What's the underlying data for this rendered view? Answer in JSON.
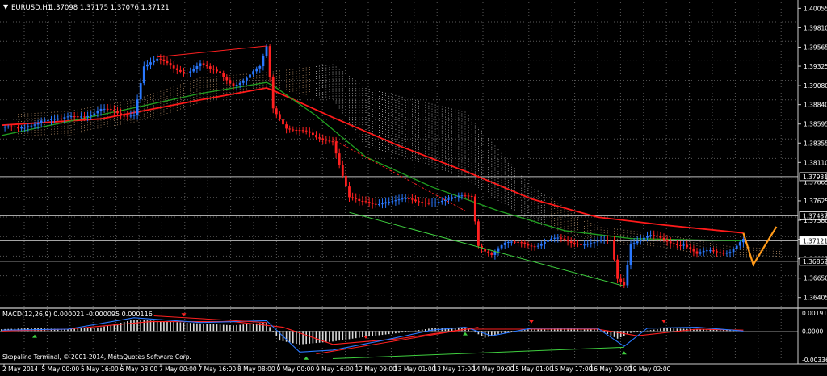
{
  "header": {
    "symbol": "EURUSD,H1",
    "quote": "1.37098 1.37175 1.37076 1.37121",
    "menu_icon": "triangle-down-icon"
  },
  "footer": {
    "copyright": "Skopalino Terminal, © 2001-2014, MetaQuotes Software Corp."
  },
  "colors": {
    "background": "#000000",
    "grid": "#5a5a5a",
    "bull": "#2a78ff",
    "bear": "#ff2020",
    "ma_red": "#ff1a1a",
    "ma_green": "#21a121",
    "cloud_white": "#d8d8d8",
    "cloud_tan": "#d4a678",
    "forecast": "#ff9a1a",
    "axis_text": "#ffffff"
  },
  "chart_data": [
    {
      "type": "candlestick",
      "title": "EURUSD,H1",
      "ylim": [
        1.3628,
        1.4013
      ],
      "y_ticks": [
        "1.40055",
        "1.39810",
        "1.39565",
        "1.39325",
        "1.39080",
        "1.38840",
        "1.38595",
        "1.38355",
        "1.38110",
        "1.37865",
        "1.37625",
        "1.37380",
        "1.37140",
        "1.36895",
        "1.36650",
        "1.36405"
      ],
      "level_labels": [
        "1.37931",
        "1.37437",
        "1.37121",
        "1.36862"
      ],
      "levels": [
        1.37931,
        1.37437,
        1.37121,
        1.36862
      ],
      "current_price": 1.37121,
      "x_ticks": [
        "2 May 2014",
        "5 May 00:00",
        "5 May 16:00",
        "6 May 08:00",
        "7 May 00:00",
        "7 May 16:00",
        "8 May 08:00",
        "9 May 00:00",
        "9 May 16:00",
        "12 May 09:00",
        "13 May 01:00",
        "13 May 17:00",
        "14 May 09:00",
        "15 May 01:00",
        "15 May 17:00",
        "16 May 09:00",
        "19 May 02:00"
      ],
      "price_path": [
        [
          0,
          1.3855
        ],
        [
          5,
          1.385
        ],
        [
          12,
          1.3868
        ],
        [
          18,
          1.3862
        ],
        [
          24,
          1.3872
        ],
        [
          30,
          1.3878
        ],
        [
          36,
          1.3868
        ],
        [
          40,
          1.3875
        ],
        [
          43,
          1.3935
        ],
        [
          47,
          1.3938
        ],
        [
          52,
          1.393
        ],
        [
          56,
          1.3928
        ],
        [
          60,
          1.3935
        ],
        [
          63,
          1.3925
        ],
        [
          66,
          1.3922
        ],
        [
          70,
          1.3912
        ],
        [
          74,
          1.3918
        ],
        [
          78,
          1.3928
        ],
        [
          80,
          1.3955
        ],
        [
          82,
          1.388
        ],
        [
          86,
          1.3858
        ],
        [
          90,
          1.385
        ],
        [
          95,
          1.384
        ],
        [
          100,
          1.3842
        ],
        [
          105,
          1.3765
        ],
        [
          108,
          1.3758
        ],
        [
          112,
          1.376
        ],
        [
          116,
          1.3765
        ],
        [
          120,
          1.3762
        ],
        [
          125,
          1.376
        ],
        [
          130,
          1.3765
        ],
        [
          136,
          1.3762
        ],
        [
          142,
          1.377
        ],
        [
          144,
          1.371
        ],
        [
          148,
          1.3695
        ],
        [
          152,
          1.3705
        ],
        [
          157,
          1.3712
        ],
        [
          162,
          1.3708
        ],
        [
          168,
          1.3712
        ],
        [
          174,
          1.3712
        ],
        [
          180,
          1.3708
        ],
        [
          184,
          1.371
        ],
        [
          186,
          1.3665
        ],
        [
          188,
          1.366
        ],
        [
          190,
          1.3712
        ],
        [
          196,
          1.3715
        ],
        [
          202,
          1.3712
        ],
        [
          206,
          1.371
        ],
        [
          210,
          1.3692
        ],
        [
          214,
          1.3698
        ],
        [
          220,
          1.3702
        ],
        [
          224,
          1.3712
        ]
      ],
      "moving_averages": [
        {
          "color": "red",
          "values": [
            [
              0,
              1.3858
            ],
            [
              30,
              1.3866
            ],
            [
              60,
              1.389
            ],
            [
              80,
              1.3905
            ],
            [
              82,
              1.3902
            ],
            [
              100,
              1.3868
            ],
            [
              120,
              1.3832
            ],
            [
              140,
              1.38
            ],
            [
              160,
              1.3765
            ],
            [
              180,
              1.3742
            ],
            [
              200,
              1.3732
            ],
            [
              224,
              1.3722
            ]
          ]
        },
        {
          "color": "green",
          "values": [
            [
              0,
              1.3845
            ],
            [
              40,
              1.388
            ],
            [
              60,
              1.3898
            ],
            [
              80,
              1.3912
            ],
            [
              82,
              1.3908
            ],
            [
              95,
              1.387
            ],
            [
              110,
              1.3818
            ],
            [
              130,
              1.378
            ],
            [
              150,
              1.375
            ],
            [
              170,
              1.3725
            ],
            [
              190,
              1.3715
            ],
            [
              224,
              1.3712
            ]
          ]
        }
      ],
      "trendlines": [
        {
          "color": "red",
          "from": [
            47,
            1.3944
          ],
          "to": [
            80,
            1.3958
          ]
        },
        {
          "color": "green",
          "from": [
            105,
            1.3748
          ],
          "to": [
            188,
            1.3655
          ]
        },
        {
          "color": "red",
          "from": [
            100,
            1.384
          ],
          "to": [
            140,
            1.375
          ]
        }
      ],
      "cloud": {
        "upper": [
          [
            4,
            1.3872
          ],
          [
            20,
            1.3876
          ],
          [
            40,
            1.389
          ],
          [
            60,
            1.3918
          ],
          [
            80,
            1.3925
          ],
          [
            100,
            1.3935
          ],
          [
            110,
            1.3905
          ],
          [
            120,
            1.3895
          ],
          [
            140,
            1.3875
          ],
          [
            160,
            1.378
          ],
          [
            180,
            1.373
          ],
          [
            200,
            1.372
          ],
          [
            220,
            1.3705
          ],
          [
            236,
            1.3702
          ]
        ],
        "lower": [
          [
            4,
            1.3843
          ],
          [
            20,
            1.3845
          ],
          [
            40,
            1.386
          ],
          [
            60,
            1.3885
          ],
          [
            80,
            1.3905
          ],
          [
            100,
            1.389
          ],
          [
            110,
            1.383
          ],
          [
            120,
            1.382
          ],
          [
            140,
            1.379
          ],
          [
            160,
            1.3735
          ],
          [
            180,
            1.371
          ],
          [
            200,
            1.3702
          ],
          [
            220,
            1.369
          ],
          [
            236,
            1.3692
          ]
        ]
      },
      "forecast": [
        [
          224,
          1.3722
        ],
        [
          227,
          1.3682
        ],
        [
          234,
          1.373
        ]
      ]
    },
    {
      "type": "bar",
      "title": "MACD(12,26,9) 0.000021 -0.000095 0.000116",
      "ylim": [
        -0.00345,
        0.00232
      ],
      "y_ticks": [
        "0.001913",
        "0.0000",
        "-0.003367"
      ],
      "y_tick_values": [
        0.001913,
        0.0,
        -0.003367
      ],
      "histogram": [
        [
          0,
          0.0002
        ],
        [
          10,
          0.0003
        ],
        [
          20,
          0.0002
        ],
        [
          30,
          0.0004
        ],
        [
          40,
          0.0012
        ],
        [
          50,
          0.001
        ],
        [
          60,
          0.0008
        ],
        [
          70,
          0.0006
        ],
        [
          80,
          0.0009
        ],
        [
          84,
          -0.001
        ],
        [
          90,
          -0.0014
        ],
        [
          100,
          -0.0011
        ],
        [
          110,
          -0.0006
        ],
        [
          120,
          -0.0002
        ],
        [
          130,
          0.0003
        ],
        [
          140,
          0.0004
        ],
        [
          146,
          -0.0007
        ],
        [
          150,
          -0.0003
        ],
        [
          160,
          0.0002
        ],
        [
          170,
          0.0003
        ],
        [
          180,
          0.0002
        ],
        [
          186,
          -0.0008
        ],
        [
          190,
          -0.0002
        ],
        [
          200,
          0.0003
        ],
        [
          210,
          0.0002
        ],
        [
          220,
          0.0001
        ],
        [
          224,
          0.0
        ]
      ],
      "macd_line": [
        [
          0,
          0.0001
        ],
        [
          20,
          0.0002
        ],
        [
          40,
          0.0014
        ],
        [
          60,
          0.0009
        ],
        [
          80,
          0.0011
        ],
        [
          90,
          -0.0022
        ],
        [
          100,
          -0.002
        ],
        [
          115,
          -0.001
        ],
        [
          130,
          0.0001
        ],
        [
          140,
          0.0004
        ],
        [
          148,
          -0.0005
        ],
        [
          160,
          0.0003
        ],
        [
          180,
          0.0003
        ],
        [
          188,
          -0.0016
        ],
        [
          195,
          0.0003
        ],
        [
          210,
          0.0004
        ],
        [
          224,
          0.0
        ]
      ],
      "signal_line": [
        [
          0,
          0.0
        ],
        [
          20,
          0.0002
        ],
        [
          45,
          0.001
        ],
        [
          70,
          0.001
        ],
        [
          85,
          0.0004
        ],
        [
          100,
          -0.0014
        ],
        [
          120,
          -0.0008
        ],
        [
          140,
          0.0002
        ],
        [
          160,
          0.0002
        ],
        [
          180,
          0.0002
        ],
        [
          192,
          -0.0005
        ],
        [
          210,
          0.0002
        ],
        [
          224,
          0.0001
        ]
      ],
      "trendlines": [
        {
          "color": "red",
          "from": [
            46,
            0.0016
          ],
          "to": [
            80,
            0.0009
          ]
        },
        {
          "color": "red",
          "from": [
            95,
            -0.0024
          ],
          "to": [
            144,
            0.0004
          ]
        },
        {
          "color": "green",
          "from": [
            100,
            -0.0029
          ],
          "to": [
            188,
            -0.0017
          ]
        }
      ],
      "arrows_up": [
        10,
        92,
        140,
        188
      ],
      "arrows_down": [
        55,
        110,
        160,
        200
      ]
    }
  ]
}
